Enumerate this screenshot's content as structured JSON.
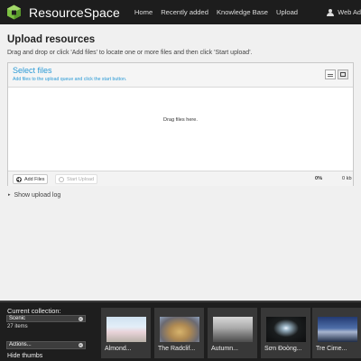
{
  "header": {
    "app_name": "ResourceSpace",
    "nav": [
      "Home",
      "Recently added",
      "Knowledge Base",
      "Upload"
    ],
    "user_label": "Web Ad"
  },
  "main": {
    "title": "Upload resources",
    "instructions": "Drag and drop or click 'Add files' to locate one or more files and then click 'Start upload'."
  },
  "uploader": {
    "title": "Select files",
    "subtitle": "Add files to the upload queue and click the start button.",
    "drop_text": "Drag files here.",
    "add_files_label": "Add Files",
    "start_upload_label": "Start Upload",
    "percent": "0%",
    "size": "0 kb"
  },
  "upload_log": {
    "label": "Show upload log"
  },
  "collection": {
    "current_label": "Current collection:",
    "selected": "Scenic",
    "item_count": "27 items",
    "actions_label": "Actions...",
    "hide_thumbs_label": "Hide thumbs",
    "thumbs": [
      {
        "caption": "Almond..."
      },
      {
        "caption": "The Radclif..."
      },
      {
        "caption": "Autumn..."
      },
      {
        "caption": "Sơn Đoòng..."
      },
      {
        "caption": "Tre Cime..."
      }
    ]
  },
  "colors": {
    "header_bg": "#1d1d1d",
    "accent_blue": "#2a9ad6",
    "logo_green": "#7cc142"
  }
}
